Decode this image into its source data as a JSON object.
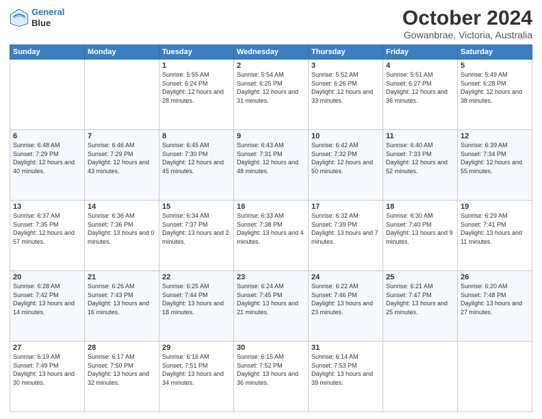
{
  "header": {
    "logo_line1": "General",
    "logo_line2": "Blue",
    "title": "October 2024",
    "subtitle": "Gowanbrae, Victoria, Australia"
  },
  "days_of_week": [
    "Sunday",
    "Monday",
    "Tuesday",
    "Wednesday",
    "Thursday",
    "Friday",
    "Saturday"
  ],
  "weeks": [
    [
      {
        "day": "",
        "info": ""
      },
      {
        "day": "",
        "info": ""
      },
      {
        "day": "1",
        "info": "Sunrise: 5:55 AM\nSunset: 6:24 PM\nDaylight: 12 hours and 28 minutes."
      },
      {
        "day": "2",
        "info": "Sunrise: 5:54 AM\nSunset: 6:25 PM\nDaylight: 12 hours and 31 minutes."
      },
      {
        "day": "3",
        "info": "Sunrise: 5:52 AM\nSunset: 6:26 PM\nDaylight: 12 hours and 33 minutes."
      },
      {
        "day": "4",
        "info": "Sunrise: 5:51 AM\nSunset: 6:27 PM\nDaylight: 12 hours and 36 minutes."
      },
      {
        "day": "5",
        "info": "Sunrise: 5:49 AM\nSunset: 6:28 PM\nDaylight: 12 hours and 38 minutes."
      }
    ],
    [
      {
        "day": "6",
        "info": "Sunrise: 6:48 AM\nSunset: 7:29 PM\nDaylight: 12 hours and 40 minutes."
      },
      {
        "day": "7",
        "info": "Sunrise: 6:46 AM\nSunset: 7:29 PM\nDaylight: 12 hours and 43 minutes."
      },
      {
        "day": "8",
        "info": "Sunrise: 6:45 AM\nSunset: 7:30 PM\nDaylight: 12 hours and 45 minutes."
      },
      {
        "day": "9",
        "info": "Sunrise: 6:43 AM\nSunset: 7:31 PM\nDaylight: 12 hours and 48 minutes."
      },
      {
        "day": "10",
        "info": "Sunrise: 6:42 AM\nSunset: 7:32 PM\nDaylight: 12 hours and 50 minutes."
      },
      {
        "day": "11",
        "info": "Sunrise: 6:40 AM\nSunset: 7:33 PM\nDaylight: 12 hours and 52 minutes."
      },
      {
        "day": "12",
        "info": "Sunrise: 6:39 AM\nSunset: 7:34 PM\nDaylight: 12 hours and 55 minutes."
      }
    ],
    [
      {
        "day": "13",
        "info": "Sunrise: 6:37 AM\nSunset: 7:35 PM\nDaylight: 12 hours and 57 minutes."
      },
      {
        "day": "14",
        "info": "Sunrise: 6:36 AM\nSunset: 7:36 PM\nDaylight: 13 hours and 0 minutes."
      },
      {
        "day": "15",
        "info": "Sunrise: 6:34 AM\nSunset: 7:37 PM\nDaylight: 13 hours and 2 minutes."
      },
      {
        "day": "16",
        "info": "Sunrise: 6:33 AM\nSunset: 7:38 PM\nDaylight: 13 hours and 4 minutes."
      },
      {
        "day": "17",
        "info": "Sunrise: 6:32 AM\nSunset: 7:39 PM\nDaylight: 13 hours and 7 minutes."
      },
      {
        "day": "18",
        "info": "Sunrise: 6:30 AM\nSunset: 7:40 PM\nDaylight: 13 hours and 9 minutes."
      },
      {
        "day": "19",
        "info": "Sunrise: 6:29 AM\nSunset: 7:41 PM\nDaylight: 13 hours and 11 minutes."
      }
    ],
    [
      {
        "day": "20",
        "info": "Sunrise: 6:28 AM\nSunset: 7:42 PM\nDaylight: 13 hours and 14 minutes."
      },
      {
        "day": "21",
        "info": "Sunrise: 6:26 AM\nSunset: 7:43 PM\nDaylight: 13 hours and 16 minutes."
      },
      {
        "day": "22",
        "info": "Sunrise: 6:25 AM\nSunset: 7:44 PM\nDaylight: 13 hours and 18 minutes."
      },
      {
        "day": "23",
        "info": "Sunrise: 6:24 AM\nSunset: 7:45 PM\nDaylight: 13 hours and 21 minutes."
      },
      {
        "day": "24",
        "info": "Sunrise: 6:22 AM\nSunset: 7:46 PM\nDaylight: 13 hours and 23 minutes."
      },
      {
        "day": "25",
        "info": "Sunrise: 6:21 AM\nSunset: 7:47 PM\nDaylight: 13 hours and 25 minutes."
      },
      {
        "day": "26",
        "info": "Sunrise: 6:20 AM\nSunset: 7:48 PM\nDaylight: 13 hours and 27 minutes."
      }
    ],
    [
      {
        "day": "27",
        "info": "Sunrise: 6:19 AM\nSunset: 7:49 PM\nDaylight: 13 hours and 30 minutes."
      },
      {
        "day": "28",
        "info": "Sunrise: 6:17 AM\nSunset: 7:50 PM\nDaylight: 13 hours and 32 minutes."
      },
      {
        "day": "29",
        "info": "Sunrise: 6:16 AM\nSunset: 7:51 PM\nDaylight: 13 hours and 34 minutes."
      },
      {
        "day": "30",
        "info": "Sunrise: 6:15 AM\nSunset: 7:52 PM\nDaylight: 13 hours and 36 minutes."
      },
      {
        "day": "31",
        "info": "Sunrise: 6:14 AM\nSunset: 7:53 PM\nDaylight: 13 hours and 39 minutes."
      },
      {
        "day": "",
        "info": ""
      },
      {
        "day": "",
        "info": ""
      }
    ]
  ]
}
